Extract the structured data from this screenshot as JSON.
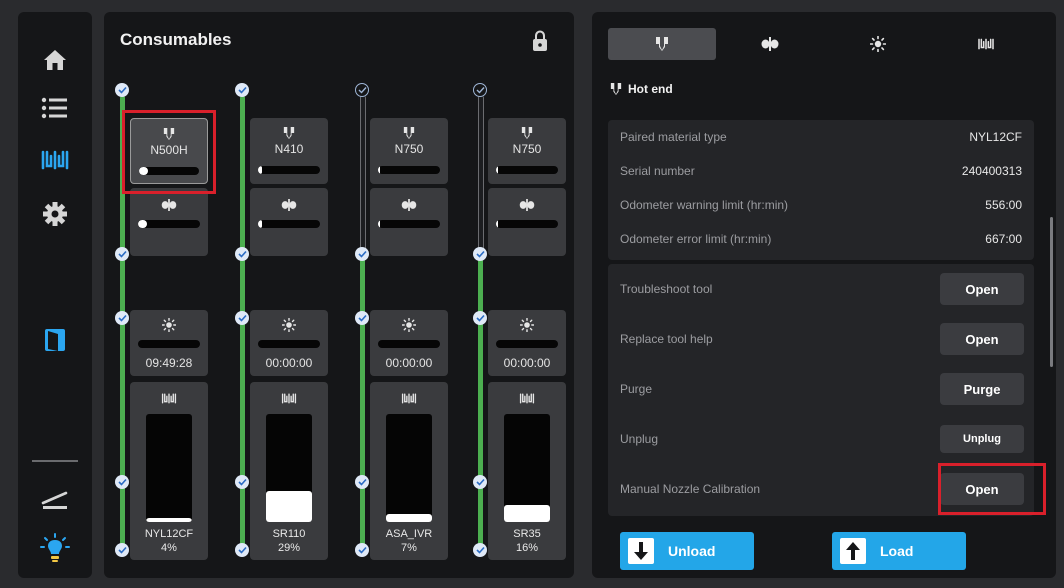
{
  "consumables": {
    "title": "Consumables",
    "columns": [
      {
        "hotend_label": "N500H",
        "hotend_level": 0.15,
        "fan_level": 0.15,
        "uv_time": "09:49:28",
        "spool_name": "NYL12CF",
        "spool_percent": "4%",
        "spool_level": 0.04,
        "line_status": "active",
        "selected": true
      },
      {
        "hotend_label": "N410",
        "hotend_level": 0.06,
        "fan_level": 0.06,
        "uv_time": "00:00:00",
        "spool_name": "SR110",
        "spool_percent": "29%",
        "spool_level": 0.29,
        "line_status": "active",
        "selected": false
      },
      {
        "hotend_label": "N750",
        "hotend_level": 0.03,
        "fan_level": 0.03,
        "uv_time": "00:00:00",
        "spool_name": "ASA_IVR",
        "spool_percent": "7%",
        "spool_level": 0.07,
        "line_status": "partial",
        "selected": false
      },
      {
        "hotend_label": "N750",
        "hotend_level": 0.01,
        "fan_level": 0.01,
        "uv_time": "00:00:00",
        "spool_name": "SR35",
        "spool_percent": "16%",
        "spool_level": 0.16,
        "line_status": "partial",
        "selected": false
      }
    ]
  },
  "details": {
    "section_title": "Hot end",
    "info": [
      {
        "key": "Paired material type",
        "value": "NYL12CF"
      },
      {
        "key": "Serial number",
        "value": "240400313"
      },
      {
        "key": "Odometer warning limit (hr:min)",
        "value": "556:00"
      },
      {
        "key": "Odometer error limit (hr:min)",
        "value": "667:00"
      }
    ],
    "actions": [
      {
        "key": "Troubleshoot tool",
        "button": "Open"
      },
      {
        "key": "Replace tool help",
        "button": "Open"
      },
      {
        "key": "Purge",
        "button": "Purge"
      },
      {
        "key": "Unplug",
        "button": "Unplug"
      },
      {
        "key": "Manual Nozzle Calibration",
        "button": "Open"
      }
    ],
    "unload_label": "Unload",
    "load_label": "Load"
  },
  "colors": {
    "accent_blue": "#23a6e8",
    "status_green": "#4caf50",
    "highlight_red": "#d9202b",
    "nav_active": "#2ba6f0"
  }
}
